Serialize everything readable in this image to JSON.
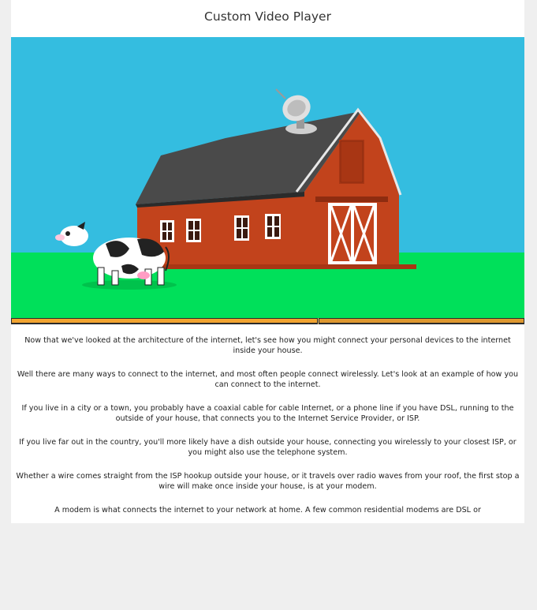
{
  "page": {
    "title": "Custom Video Player"
  },
  "player": {
    "progress_fraction": 0.6,
    "scene": {
      "sky_color": "#34bde0",
      "grass_color": "#00e05a",
      "barn_color": "#c2431c",
      "roof_color": "#4a4a4a",
      "icons": [
        "satellite-dish-icon",
        "barn-icon",
        "cow-icon"
      ]
    }
  },
  "transcript": {
    "paragraphs": [
      "Now that we've looked at the architecture of the internet, let's see how you might connect your personal devices to the internet inside your house.",
      "Well there are many ways to connect to the internet, and most often people connect wirelessly. Let's look at an example of how you can connect to the internet.",
      "If you live in a city or a town, you probably have a coaxial cable for cable Internet, or a phone line if you have DSL, running to the outside of your house, that connects you to the Internet Service Provider, or ISP.",
      "If you live far out in the country, you'll more likely have a dish outside your house, connecting you wirelessly to your closest ISP, or you might also use the telephone system.",
      "Whether a wire comes straight from the ISP hookup outside your house, or it travels over radio waves from your roof, the first stop a wire will make once inside your house, is at your modem.",
      "A modem is what connects the internet to your network at home. A few common residential modems are DSL or"
    ]
  }
}
